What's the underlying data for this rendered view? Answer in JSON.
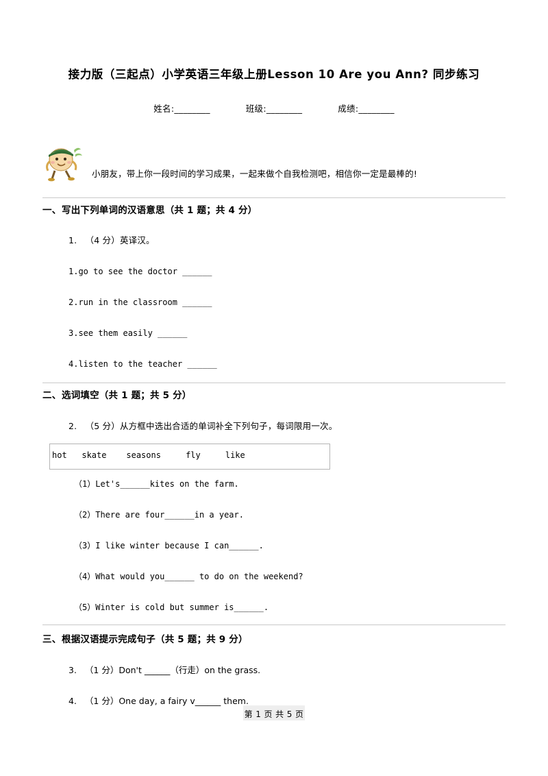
{
  "document": {
    "title": "接力版（三起点）小学英语三年级上册Lesson 10 Are you Ann? 同步练习",
    "info_fields": [
      "姓名:________",
      "班级:________",
      "成绩:________"
    ],
    "mascot_note": "小朋友，带上你一段时间的学习成果，一起来做个自我检测吧，相信你一定是最棒的!",
    "footer": "第 1 页 共 5 页"
  },
  "sections": [
    {
      "num": "一、",
      "title": "写出下列单词的汉语意思（共 1 题；共 4 分）",
      "questions": [
        {
          "label": "1.",
          "prompt": "（4 分）英译汉。",
          "items": [
            "1.go to see the doctor ______",
            "2.run in the classroom ______",
            "3.see them easily ______",
            "4.listen to the teacher ______"
          ]
        }
      ]
    },
    {
      "num": "二、",
      "title": "选词填空（共 1 题；共 5 分）",
      "questions": [
        {
          "label": "2.",
          "prompt": "（5 分）从方框中选出合适的单词补全下列句子，每词限用一次。",
          "wordbank": "hot   skate    seasons     fly     like",
          "items": [
            "（1）Let's______kites on the farm.",
            "（2）There are four______in a year.",
            "（3）I like winter because I can______.",
            "（4）What would you______ to do on the weekend?",
            "（5）Winter is cold but summer is______."
          ]
        }
      ]
    },
    {
      "num": "三、",
      "title": "根据汉语提示完成句子（共 5 题；共 9 分）",
      "questions": [
        {
          "label": "3.",
          "prompt_cn": "（1 分）Don't ______（行走）on the grass."
        },
        {
          "label": "4.",
          "prompt_cn": "（1 分）One day, a fairy v______ them."
        }
      ]
    }
  ]
}
